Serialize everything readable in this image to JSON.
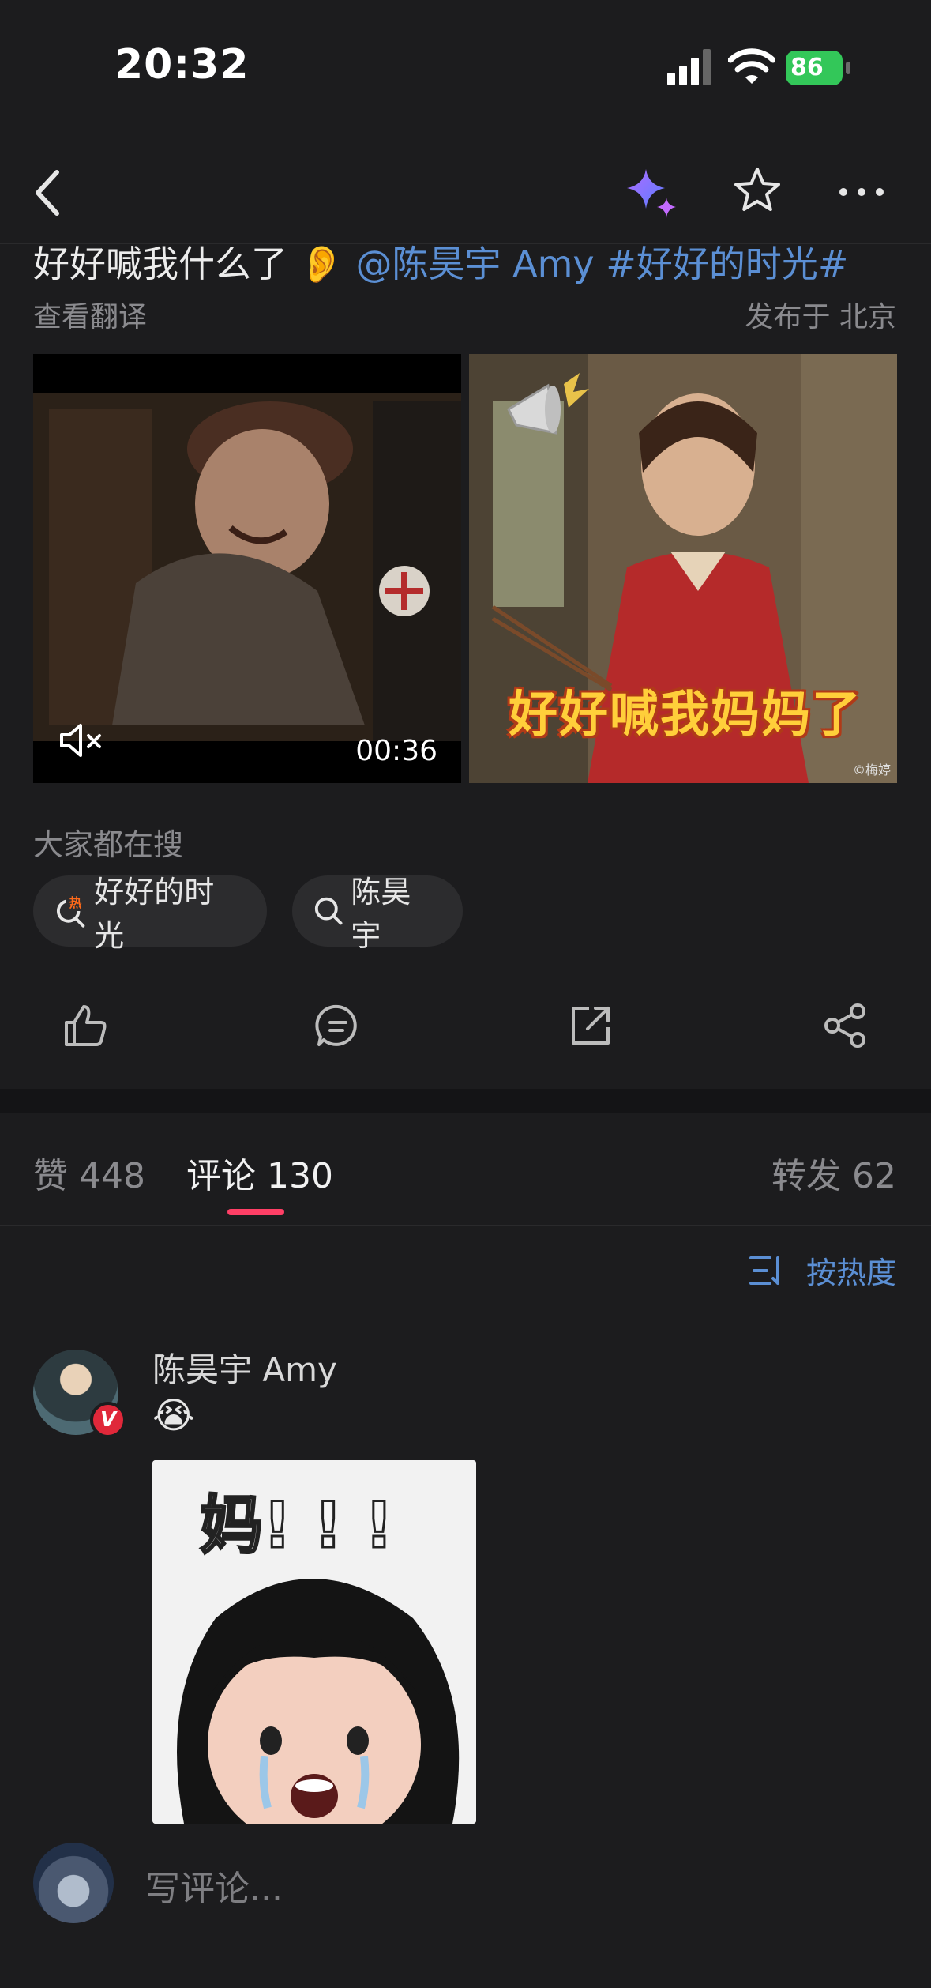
{
  "status_bar": {
    "time": "20:32",
    "battery": "86"
  },
  "post": {
    "text_prefix": "好好喊我什么了",
    "ear_emoji": "👂",
    "mention": "@陈昊宇 Amy",
    "hashtag": "#好好的时光#",
    "translate_label": "查看翻译",
    "location": "发布于 北京"
  },
  "media": {
    "video_duration": "00:36",
    "image_caption": "好好喊我妈妈了",
    "watermark": "©梅婷"
  },
  "trending": {
    "title": "大家都在搜",
    "chips": [
      {
        "label": "好好的时光",
        "badge": "热"
      },
      {
        "label": "陈昊宇"
      }
    ]
  },
  "tabs": {
    "likes": "赞 448",
    "comments": "评论 130",
    "reposts": "转发 62"
  },
  "sort": {
    "label": "按热度"
  },
  "comment": {
    "author": "陈昊宇 Amy",
    "verified": "V",
    "emoji": "😭",
    "sticker_text": "妈! ! !"
  },
  "composer": {
    "placeholder": "写评论..."
  },
  "colors": {
    "accent_link": "#5b8fd4",
    "tab_indicator": "#ff3f66",
    "battery": "#33c759"
  }
}
